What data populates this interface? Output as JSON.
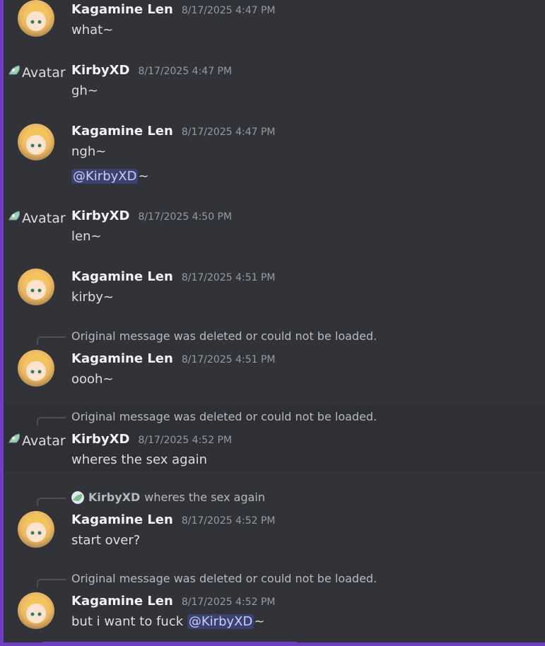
{
  "messages": [
    {
      "author": "Kagamine Len",
      "time": "8/17/2025 4:47 PM",
      "lines": [
        "what~"
      ],
      "avatar": "len-avatar"
    },
    {
      "author": "KirbyXD",
      "time": "8/17/2025 4:47 PM",
      "lines": [
        "gh~"
      ],
      "avatar_alt": "Avatar"
    },
    {
      "author": "Kagamine Len",
      "time": "8/17/2025 4:47 PM",
      "lines": [
        "ngh~"
      ],
      "mention_line": {
        "mention": "@KirbyXD",
        "suffix": "~"
      },
      "avatar": "len-avatar"
    },
    {
      "author": "KirbyXD",
      "time": "8/17/2025 4:50 PM",
      "lines": [
        "len~"
      ],
      "avatar_alt": "Avatar"
    },
    {
      "author": "Kagamine Len",
      "time": "8/17/2025 4:51 PM",
      "lines": [
        "kirby~"
      ],
      "avatar": "len-avatar"
    },
    {
      "author": "Kagamine Len",
      "time": "8/17/2025 4:51 PM",
      "lines": [
        "oooh~"
      ],
      "reply": "Original message was deleted or could not be loaded.",
      "avatar": "len-avatar"
    },
    {
      "author": "KirbyXD",
      "time": "8/17/2025 4:52 PM",
      "lines": [
        "wheres the sex again"
      ],
      "reply": "Original message was deleted or could not be loaded.",
      "avatar_alt": "Avatar"
    },
    {
      "author": "Kagamine Len",
      "time": "8/17/2025 4:52 PM",
      "lines": [
        "start over?"
      ],
      "reply_author": "KirbyXD",
      "reply_content": "wheres the sex again",
      "avatar": "len-avatar"
    },
    {
      "author": "Kagamine Len",
      "time": "8/17/2025 4:52 PM",
      "text_prefix": "but i want to fuck ",
      "mention": "@KirbyXD",
      "suffix": "~",
      "reply": "Original message was deleted or could not be loaded.",
      "avatar": "len-avatar"
    }
  ],
  "colors": {
    "background": "#313338",
    "accent": "#6f3fc1",
    "mention_bg": "#3c4270",
    "mention_fg": "#c9cdfb"
  }
}
